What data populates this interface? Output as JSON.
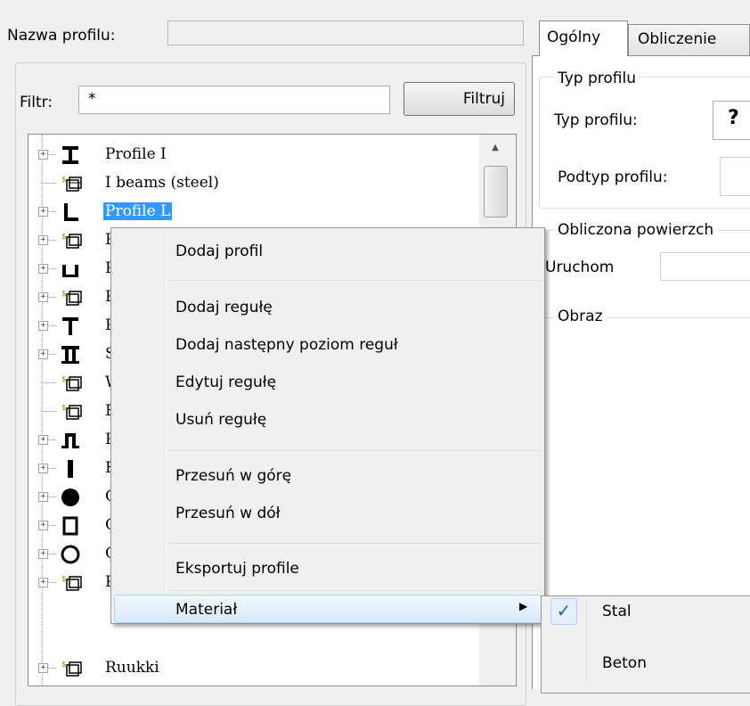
{
  "profile_name": {
    "label": "Nazwa profilu:",
    "value": ""
  },
  "filter": {
    "label": "Filtr:",
    "value": "*",
    "button": "Filtruj"
  },
  "tree": {
    "items": [
      {
        "label": "Profile I",
        "icon": "i-beam-icon",
        "expandable": true,
        "selected": false
      },
      {
        "label": "I beams (steel)",
        "icon": "rule-set-icon",
        "expandable": false,
        "selected": false
      },
      {
        "label": "Profile L",
        "icon": "l-profile-icon",
        "expandable": true,
        "selected": true
      },
      {
        "label": "P",
        "icon": "rule-set-icon",
        "expandable": true,
        "selected": false
      },
      {
        "label": "P",
        "icon": "u-profile-icon",
        "expandable": true,
        "selected": false
      },
      {
        "label": "P",
        "icon": "rule-set-icon",
        "expandable": true,
        "selected": false
      },
      {
        "label": "P",
        "icon": "t-profile-icon",
        "expandable": true,
        "selected": false
      },
      {
        "label": "S",
        "icon": "double-t-profile-icon",
        "expandable": true,
        "selected": false
      },
      {
        "label": "W",
        "icon": "rule-set-icon",
        "expandable": false,
        "selected": false
      },
      {
        "label": "E",
        "icon": "rule-set-icon",
        "expandable": false,
        "selected": false
      },
      {
        "label": "P",
        "icon": "omega-profile-icon",
        "expandable": true,
        "selected": false
      },
      {
        "label": "F",
        "icon": "flat-bar-icon",
        "expandable": true,
        "selected": false
      },
      {
        "label": "C",
        "icon": "round-bar-icon",
        "expandable": true,
        "selected": false
      },
      {
        "label": "C",
        "icon": "rect-tube-icon",
        "expandable": true,
        "selected": false
      },
      {
        "label": "C",
        "icon": "circular-tube-icon",
        "expandable": true,
        "selected": false
      },
      {
        "label": "P",
        "icon": "rule-set-icon",
        "expandable": true,
        "selected": false
      },
      {
        "label": "Ruukki",
        "icon": "rule-set-icon",
        "expandable": true,
        "selected": false
      }
    ]
  },
  "tabs": [
    {
      "label": "Ogólny",
      "active": true
    },
    {
      "label": "Obliczenie",
      "active": false
    }
  ],
  "general_tab": {
    "type_group_title": "Typ profilu",
    "type_label": "Typ profilu:",
    "type_value": "?",
    "subtype_label": "Podtyp profilu:",
    "calc_group_title": "Obliczona powierzch",
    "run_label": "Uruchom",
    "image_group_title": "Obraz"
  },
  "context_menu": {
    "items": [
      "Dodaj profil",
      "Dodaj regułę",
      "Dodaj następny poziom reguł",
      "Edytuj regułę",
      "Usuń regułę",
      "Przesuń w górę",
      "Przesuń w dół",
      "Eksportuj profile",
      "Materiał"
    ],
    "highlighted": "Materiał"
  },
  "submenu": {
    "items": [
      {
        "label": "Stal",
        "checked": true
      },
      {
        "label": "Beton",
        "checked": false
      }
    ]
  },
  "colors": {
    "selection": "#3399ff",
    "menu_highlight": "#d8e9fb",
    "check": "#1c5fb0"
  }
}
